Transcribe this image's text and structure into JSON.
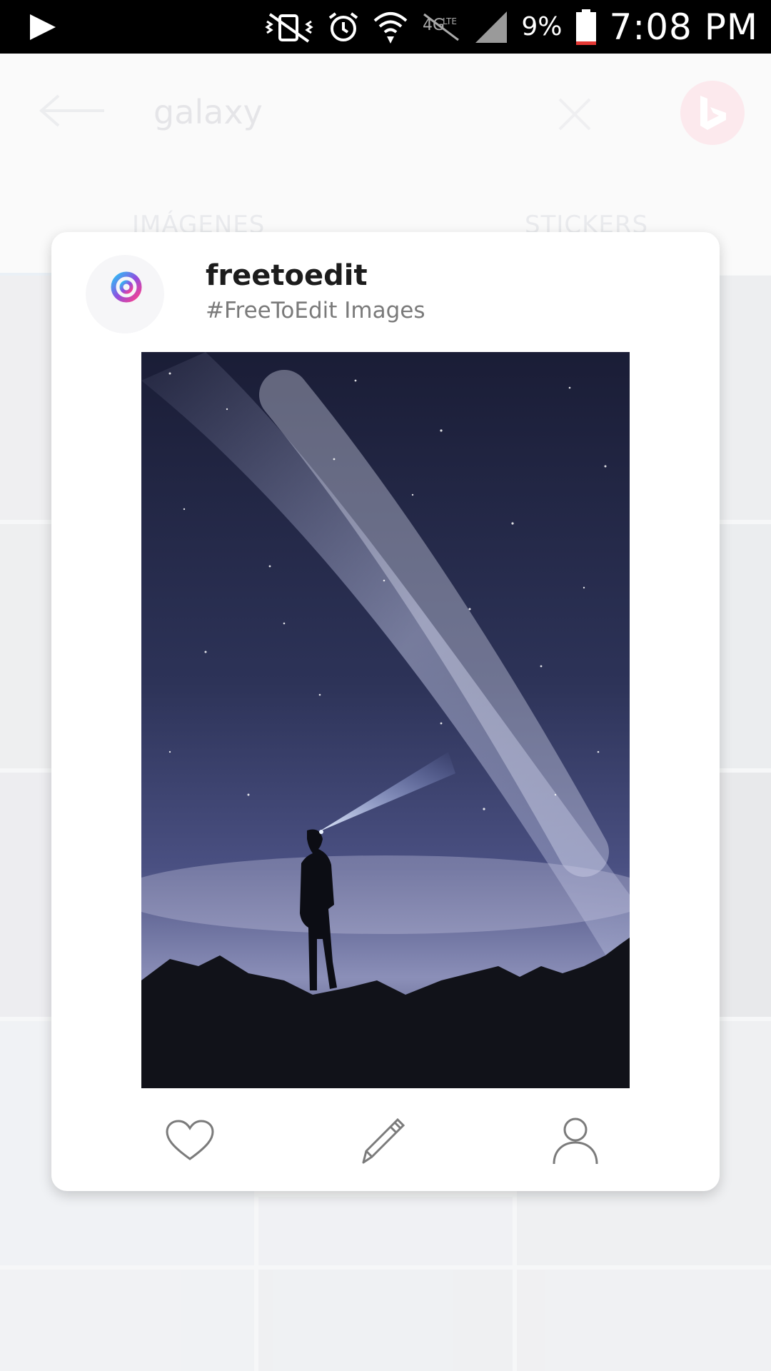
{
  "status_bar": {
    "battery_percent": "9%",
    "time": "7:08 PM",
    "icons": [
      "play-icon",
      "vibrate-mute-icon",
      "alarm-icon",
      "wifi-icon",
      "lte-icon",
      "signal-icon",
      "battery-icon"
    ]
  },
  "header": {
    "search_query": "galaxy",
    "icons": [
      "back-arrow-icon",
      "clear-icon",
      "bing-icon"
    ]
  },
  "tabs": [
    {
      "label": "IMÁGENES",
      "selected": true
    },
    {
      "label": "STICKERS",
      "selected": false
    }
  ],
  "dialog": {
    "title": "freetoedit",
    "subtitle": "#FreeToEdit Images",
    "logo": "picsart-logo",
    "image_alt": "person with headlamp under milky way",
    "actions": [
      "heart-icon",
      "pencil-icon",
      "user-icon"
    ]
  },
  "colors": {
    "status_bar": "#000000",
    "card": "#ffffff",
    "accent_bing": "#fadde3"
  }
}
